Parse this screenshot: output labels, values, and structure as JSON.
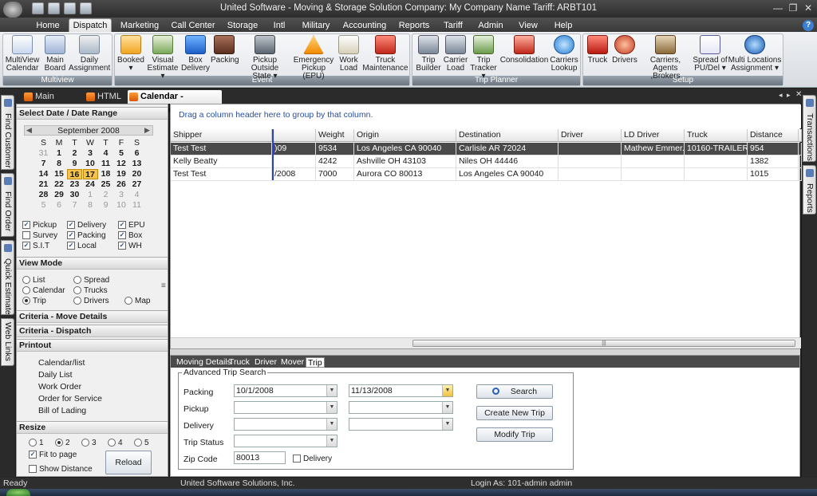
{
  "window": {
    "title": "United Software - Moving & Storage Solution    Company: My Company Name  Tariff: ARBT101"
  },
  "ribbon_tabs": [
    "Home",
    "Dispatch",
    "Marketing",
    "Call Center",
    "Storage",
    "Intl",
    "Military",
    "Accounting",
    "Reports",
    "Tariff",
    "Admin",
    "View",
    "Help"
  ],
  "ribbon": {
    "groups": [
      "Multiview",
      "Event",
      "Trip Planner",
      "Setup"
    ],
    "multiview": [
      {
        "l1": "MultiView",
        "l2": "Calendar",
        "icon": "calendar-icon"
      },
      {
        "l1": "Main",
        "l2": "Board",
        "icon": "board-icon"
      },
      {
        "l1": "Daily",
        "l2": "Assignment",
        "icon": "assignment-icon"
      }
    ],
    "event": [
      {
        "l1": "Booked",
        "l2": "▾",
        "icon": "booked-icon"
      },
      {
        "l1": "Visual",
        "l2": "Estimate ▾",
        "icon": "estimate-icon"
      },
      {
        "l1": "Box",
        "l2": "Delivery",
        "icon": "box-icon"
      },
      {
        "l1": "Packing",
        "l2": "",
        "icon": "packing-icon"
      },
      {
        "l1": "Pickup Outside",
        "l2": "State ▾",
        "icon": "road-icon"
      },
      {
        "l1": "Emergency",
        "l2": "Pickup (EPU)",
        "icon": "warning-icon"
      },
      {
        "l1": "Work",
        "l2": "Load",
        "icon": "workload-icon"
      },
      {
        "l1": "Truck",
        "l2": "Maintenance",
        "icon": "truck-maint-icon"
      }
    ],
    "trip_planner": [
      {
        "l1": "Trip",
        "l2": "Builder",
        "icon": "trip-builder-icon"
      },
      {
        "l1": "Carrier",
        "l2": "Load",
        "icon": "carrier-load-icon"
      },
      {
        "l1": "Trip",
        "l2": "Tracker ▾",
        "icon": "tracker-icon"
      },
      {
        "l1": "Consolidation",
        "l2": "",
        "icon": "consolidation-icon"
      },
      {
        "l1": "Carriers",
        "l2": "Lookup",
        "icon": "lookup-icon"
      }
    ],
    "setup": [
      {
        "l1": "Truck",
        "l2": "",
        "icon": "truck-icon"
      },
      {
        "l1": "Drivers",
        "l2": "",
        "icon": "driver-icon"
      },
      {
        "l1": "Carriers, Agents",
        "l2": ",Brokers",
        "icon": "agents-icon"
      },
      {
        "l1": "Spread of",
        "l2": "PU/Del ▾",
        "icon": "spread-icon"
      },
      {
        "l1": "Multi Locations",
        "l2": "Assignment ▾",
        "icon": "globe-icon"
      }
    ]
  },
  "doc_tabs": [
    "Main Screen",
    "HTML",
    "Calendar - Multiview"
  ],
  "side_tabs_left": [
    "Find Customer",
    "Find Order",
    "Quick Estimate",
    "Web Links"
  ],
  "side_tabs_right": [
    "Transactions",
    "Reports"
  ],
  "left_panel": {
    "date_header": "Select Date / Date Range",
    "month": "September 2008",
    "weekdays": [
      "S",
      "M",
      "T",
      "W",
      "T",
      "F",
      "S"
    ],
    "weeks": [
      [
        "31",
        "1",
        "2",
        "3",
        "4",
        "5",
        "6"
      ],
      [
        "7",
        "8",
        "9",
        "10",
        "11",
        "12",
        "13"
      ],
      [
        "14",
        "15",
        "16",
        "17",
        "18",
        "19",
        "20"
      ],
      [
        "21",
        "22",
        "23",
        "24",
        "25",
        "26",
        "27"
      ],
      [
        "28",
        "29",
        "30",
        "1",
        "2",
        "3",
        "4"
      ],
      [
        "5",
        "6",
        "7",
        "8",
        "9",
        "10",
        "11"
      ]
    ],
    "filters": [
      {
        "label": "Pickup",
        "checked": true
      },
      {
        "label": "Delivery",
        "checked": true
      },
      {
        "label": "EPU",
        "checked": true
      },
      {
        "label": "Survey",
        "checked": false
      },
      {
        "label": "Packing",
        "checked": true
      },
      {
        "label": "Box",
        "checked": true
      },
      {
        "label": "S.I.T",
        "checked": true
      },
      {
        "label": "Local",
        "checked": true
      },
      {
        "label": "WH",
        "checked": true
      }
    ],
    "view_mode_header": "View Mode",
    "view_modes": [
      "List",
      "Spread",
      "Calendar",
      "Trucks",
      "Trip",
      "Drivers",
      "Map"
    ],
    "criteria_move": "Criteria - Move Details",
    "criteria_dispatch": "Criteria - Dispatch",
    "printout_header": "Printout",
    "printouts": [
      "Calendar/list",
      "Daily List",
      "Work Order",
      "Order for Service",
      "Bill of Lading"
    ],
    "resize_header": "Resize",
    "resize_options": [
      "1",
      "2",
      "3",
      "4",
      "5"
    ],
    "fit_to_page": "Fit to page",
    "show_distance": "Show Distance",
    "reload_button": "Reload Appt."
  },
  "grid": {
    "group_hint": "Drag a column header here to group by that column.",
    "columns": [
      "Shipper",
      "",
      "Weight",
      "Origin",
      "Destination",
      "Driver",
      "LD Driver",
      "Truck",
      "Distance"
    ],
    "rows": [
      [
        "Test Test",
        ")09",
        "9534",
        "Los Angeles CA 90040",
        "Carlisle AR 72024",
        "",
        "Mathew Emmer...",
        "10160-TRAILER",
        "954"
      ],
      [
        "Kelly Beatty",
        "",
        "4242",
        "Ashville OH 43103",
        "Niles OH 44446",
        "",
        "",
        "",
        "1382"
      ],
      [
        "Test Test",
        "/2008",
        "7000",
        "Aurora CO 80013",
        "Los Angeles CA 90040",
        "",
        "",
        "",
        "1015"
      ]
    ]
  },
  "bottom": {
    "tabs": [
      "Moving Details",
      "Truck",
      "Driver",
      "Mover",
      "Trip"
    ],
    "search_legend": "Advanced Trip Search",
    "packing_label": "Packing",
    "packing_from": "10/1/2008",
    "packing_to": "11/13/2008",
    "pickup_label": "Pickup",
    "delivery_label": "Delivery",
    "trip_status_label": "Trip Status",
    "zip_label": "Zip Code",
    "zip_value": "80013",
    "delivery_check": "Delivery",
    "search_button": "Search",
    "create_button": "Create New Trip",
    "modify_button": "Modify Trip"
  },
  "status": {
    "ready": "Ready",
    "company": "United Software Solutions, Inc.",
    "login": "Login As: 101-admin admin"
  }
}
